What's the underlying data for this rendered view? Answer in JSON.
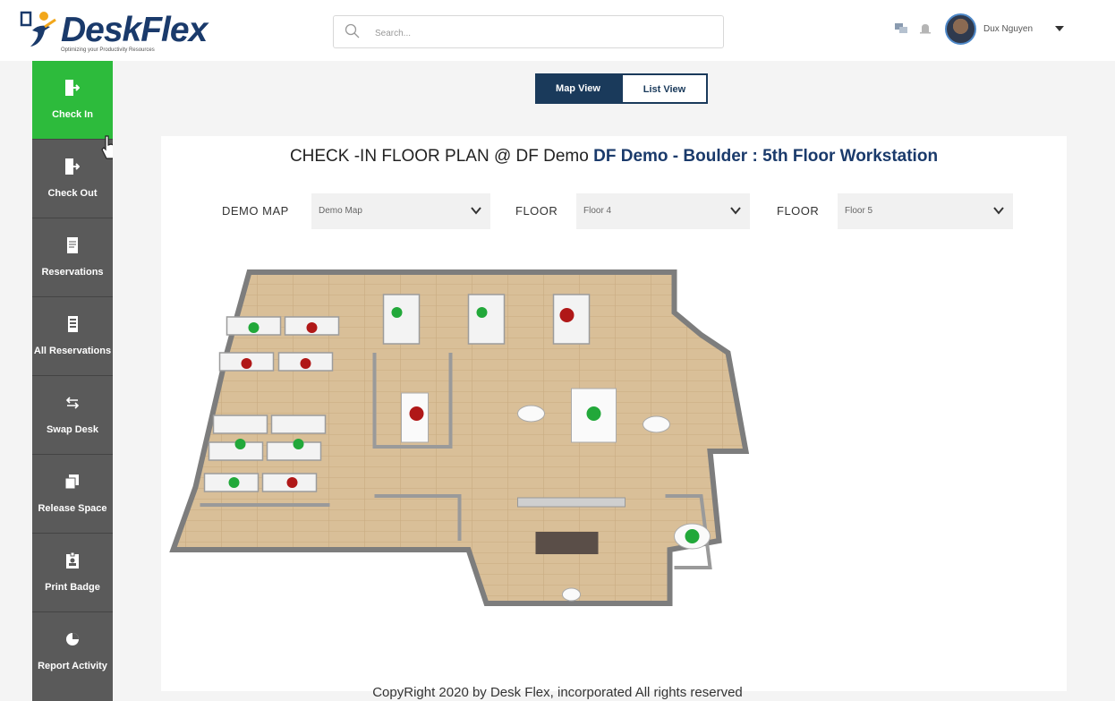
{
  "header": {
    "logo_text": "DeskFlex",
    "logo_tagline": "Optimizing your Productivity Resources",
    "search_placeholder": "Search...",
    "icons": [
      "chat-icon",
      "bell-icon"
    ],
    "user_name": "Dux Nguyen"
  },
  "sidebar": {
    "items": [
      {
        "label": "Check In",
        "icon": "check-in-icon",
        "active": true
      },
      {
        "label": "Check Out",
        "icon": "check-out-icon"
      },
      {
        "label": "Reservations",
        "icon": "reservations-icon"
      },
      {
        "label": "All Reservations",
        "icon": "all-reservations-icon"
      },
      {
        "label": "Swap Desk",
        "icon": "swap-icon"
      },
      {
        "label": "Release Space",
        "icon": "release-space-icon"
      },
      {
        "label": "Print Badge",
        "icon": "badge-icon"
      },
      {
        "label": "Report Activity",
        "icon": "pie-chart-icon"
      }
    ]
  },
  "view_toggle": {
    "map_label": "Map View",
    "list_label": "List View",
    "selected": "Map View"
  },
  "plan": {
    "title_prefix": "CHECK -IN FLOOR PLAN @ DF Demo",
    "title_highlight": "DF Demo - Boulder : 5th Floor Workstation"
  },
  "filters": [
    {
      "label": "DEMO MAP",
      "value": "Demo Map"
    },
    {
      "label": "FLOOR",
      "value": "Floor 4"
    },
    {
      "label": "FLOOR",
      "value": "Floor 5"
    }
  ],
  "desk_status_colors": {
    "available": "#22a83a",
    "occupied": "#b01818"
  },
  "copyright": "CopyRight 2020 by Desk Flex, incorporated All rights reserved"
}
